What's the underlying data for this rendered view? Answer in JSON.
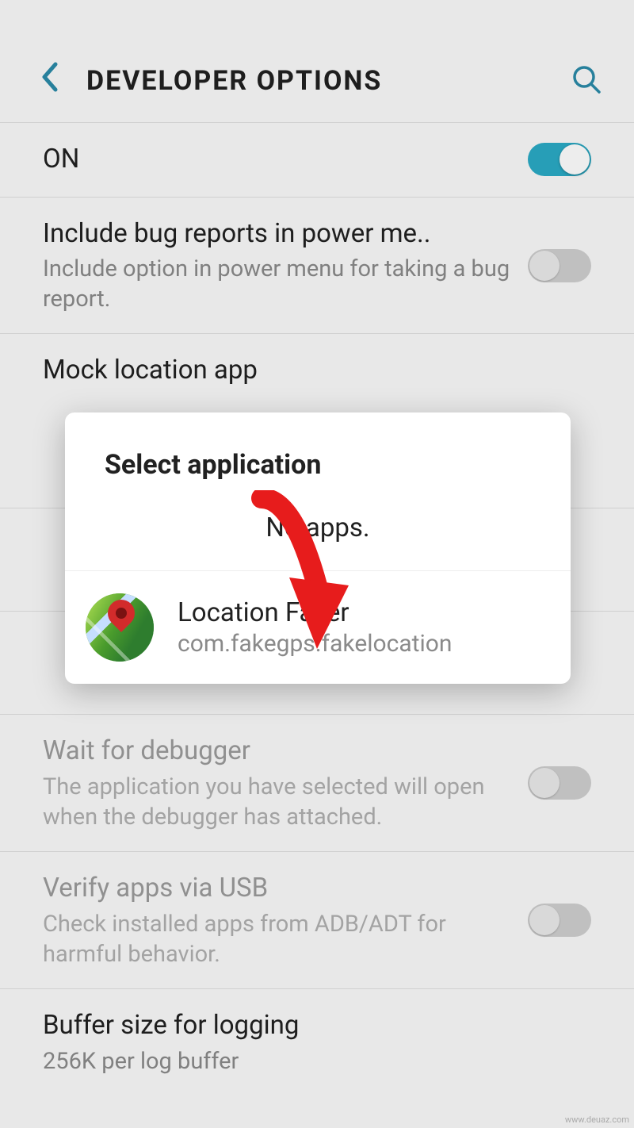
{
  "header": {
    "title": "DEVELOPER OPTIONS"
  },
  "items": {
    "on": {
      "label": "ON"
    },
    "bug": {
      "title": "Include bug reports in power me..",
      "sub": "Include option in power menu for taking a bug report."
    },
    "mock": {
      "title": "Mock location app"
    },
    "wait": {
      "title": "Wait for debugger",
      "sub": "The application you have selected will open when the debugger has attached."
    },
    "verify": {
      "title": "Verify apps via USB",
      "sub": "Check installed apps from ADB/ADT for harmful behavior."
    },
    "buffer": {
      "title": "Buffer size for logging",
      "sub": "256K per log buffer"
    }
  },
  "dialog": {
    "title": "Select application",
    "option_none": "No apps.",
    "option_app": {
      "name": "Location Faker",
      "package": "com.fakegps.fakelocation"
    }
  },
  "watermark": "www.deuaz.com"
}
